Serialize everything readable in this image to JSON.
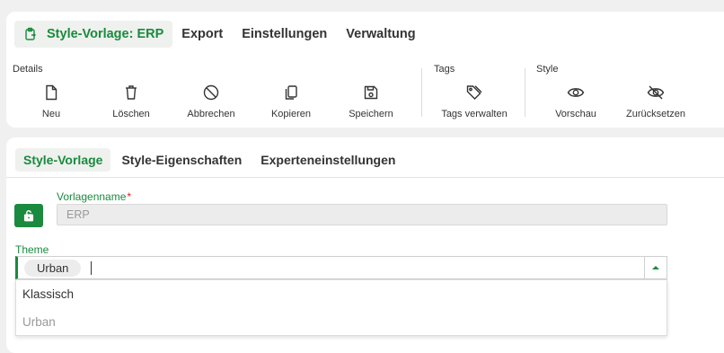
{
  "ribbon": {
    "tabs": [
      {
        "label": "Style-Vorlage: ERP"
      },
      {
        "label": "Export"
      },
      {
        "label": "Einstellungen"
      },
      {
        "label": "Verwaltung"
      }
    ],
    "groups": {
      "details": "Details",
      "tags": "Tags",
      "style": "Style"
    },
    "buttons": {
      "new": "Neu",
      "delete": "Löschen",
      "cancel": "Abbrechen",
      "copy": "Kopieren",
      "save": "Speichern",
      "manage_tags": "Tags verwalten",
      "preview": "Vorschau",
      "reset": "Zurücksetzen"
    }
  },
  "form": {
    "subtabs": [
      {
        "label": "Style-Vorlage"
      },
      {
        "label": "Style-Eigenschaften"
      },
      {
        "label": "Experteneinstellungen"
      }
    ],
    "template_name": {
      "label": "Vorlagenname",
      "required_mark": "*",
      "value": "ERP"
    },
    "theme": {
      "label": "Theme",
      "selected": "Urban",
      "options": [
        "Klassisch",
        "Urban"
      ]
    }
  },
  "colors": {
    "accent": "#1a8a3e",
    "option_disabled": "#999999"
  }
}
